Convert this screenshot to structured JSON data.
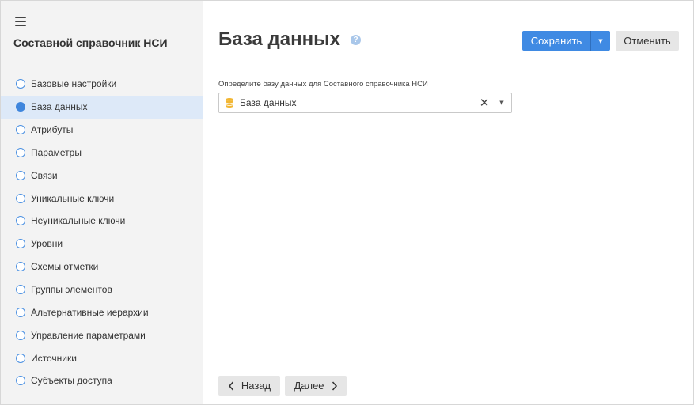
{
  "sidebar": {
    "title": "Составной справочник НСИ",
    "menu_icon": "hamburger-icon",
    "steps": [
      {
        "label": "Базовые настройки",
        "active": false
      },
      {
        "label": "База данных",
        "active": true
      },
      {
        "label": "Атрибуты",
        "active": false
      },
      {
        "label": "Параметры",
        "active": false
      },
      {
        "label": "Связи",
        "active": false
      },
      {
        "label": "Уникальные ключи",
        "active": false
      },
      {
        "label": "Неуникальные ключи",
        "active": false
      },
      {
        "label": "Уровни",
        "active": false
      },
      {
        "label": "Схемы отметки",
        "active": false
      },
      {
        "label": "Группы элементов",
        "active": false
      },
      {
        "label": "Альтернативные иерархии",
        "active": false
      },
      {
        "label": "Управление параметрами",
        "active": false
      },
      {
        "label": "Источники",
        "active": false
      },
      {
        "label": "Субъекты доступа",
        "active": false
      }
    ]
  },
  "header": {
    "title": "База данных",
    "help_icon": "question-icon",
    "help_glyph": "?",
    "save_label": "Сохранить",
    "cancel_label": "Отменить"
  },
  "form": {
    "db_label": "Определите базу данных для Составного справочника НСИ",
    "db_value": "База данных",
    "db_icon": "database-icon"
  },
  "footer": {
    "back_label": "Назад",
    "next_label": "Далее"
  },
  "colors": {
    "accent": "#3f8ae3",
    "active_step_bg": "#dde9f8",
    "sidebar_bg": "#f3f3f3",
    "db_icon": "#f2b632"
  }
}
